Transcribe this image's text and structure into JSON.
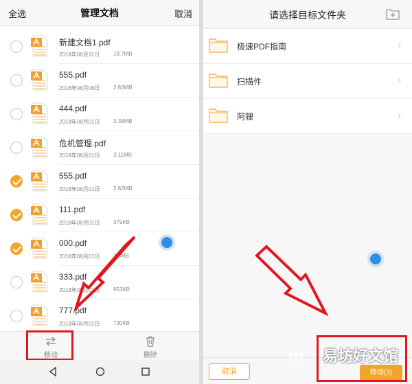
{
  "left": {
    "header": {
      "select_all": "全选",
      "title": "管理文档",
      "cancel": "取消"
    },
    "files": [
      {
        "name": "新建文档1.pdf",
        "date": "2018年08月11日",
        "size": "18.7MB",
        "checked": false
      },
      {
        "name": "555.pdf",
        "date": "2018年08月08日",
        "size": "2.82MB",
        "checked": false
      },
      {
        "name": "444.pdf",
        "date": "2018年08月01日",
        "size": "3.38MB",
        "checked": false
      },
      {
        "name": "危机管理.pdf",
        "date": "2018年08月01日",
        "size": "3.11MB",
        "checked": false
      },
      {
        "name": "555.pdf",
        "date": "2018年08月01日",
        "size": "2.82MB",
        "checked": true
      },
      {
        "name": "111.pdf",
        "date": "2018年08月01日",
        "size": "379KB",
        "checked": true
      },
      {
        "name": "000.pdf",
        "date": "2018年08月01日",
        "size": "1.5MB",
        "checked": true
      },
      {
        "name": "333.pdf",
        "date": "2018年08月01日",
        "size": "953KB",
        "checked": false
      },
      {
        "name": "777.pdf",
        "date": "2018年08月01日",
        "size": "730KB",
        "checked": false
      }
    ],
    "toolbar": {
      "move_label": "移动",
      "delete_label": "删除"
    }
  },
  "right": {
    "header": {
      "title": "请选择目标文件夹"
    },
    "folders": [
      {
        "label": "极速PDF指南"
      },
      {
        "label": "扫描件"
      },
      {
        "label": "阿狸"
      }
    ],
    "bottom": {
      "cancel_label": "取消",
      "move_label": "移动(3)"
    }
  },
  "watermark": "易坊好文馆",
  "colors": {
    "accent": "#f3a528",
    "highlight": "#e0171c",
    "pdf_icon": "#f0a030",
    "float_dot": "#2f8de4"
  }
}
